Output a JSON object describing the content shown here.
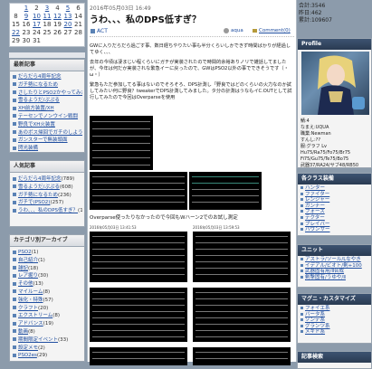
{
  "top_stats": {
    "visitors": "合計:3546",
    "today": "昨日:462",
    "total": "累計:109607"
  },
  "calendar": {
    "rows": [
      [
        {
          "t": "",
          "c": ""
        },
        {
          "t": "1",
          "c": "lnk"
        },
        {
          "t": "2",
          "c": ""
        },
        {
          "t": "3",
          "c": "lnk"
        },
        {
          "t": "4",
          "c": ""
        },
        {
          "t": "5",
          "c": "lnk"
        },
        {
          "t": "6",
          "c": ""
        }
      ],
      [
        {
          "t": "8",
          "c": ""
        },
        {
          "t": "9",
          "c": "lnk"
        },
        {
          "t": "10",
          "c": "lnk"
        },
        {
          "t": "11",
          "c": "lnk"
        },
        {
          "t": "12",
          "c": "lnk"
        },
        {
          "t": "13",
          "c": "lnk"
        },
        {
          "t": "14",
          "c": ""
        }
      ],
      [
        {
          "t": "15",
          "c": ""
        },
        {
          "t": "16",
          "c": ""
        },
        {
          "t": "17",
          "c": "lnk"
        },
        {
          "t": "18",
          "c": ""
        },
        {
          "t": "19",
          "c": ""
        },
        {
          "t": "20",
          "c": "lnk"
        },
        {
          "t": "21",
          "c": ""
        }
      ],
      [
        {
          "t": "22",
          "c": "lnk"
        },
        {
          "t": "23",
          "c": ""
        },
        {
          "t": "24",
          "c": ""
        },
        {
          "t": "25",
          "c": ""
        },
        {
          "t": "26",
          "c": ""
        },
        {
          "t": "27",
          "c": ""
        },
        {
          "t": "28",
          "c": ""
        }
      ],
      [
        {
          "t": "29",
          "c": ""
        },
        {
          "t": "30",
          "c": ""
        },
        {
          "t": "31",
          "c": ""
        },
        {
          "t": "",
          "c": ""
        },
        {
          "t": "",
          "c": ""
        },
        {
          "t": "",
          "c": ""
        },
        {
          "t": "",
          "c": ""
        }
      ]
    ]
  },
  "recent_posts": {
    "title": "最新記事",
    "items": [
      "だらだら4周年記念",
      "ガチ勢になるため",
      "さしたりとPSO2かやってみた",
      "雪るようだ/ぷぷる",
      "XH前方装置/XH",
      "テーセンでノンウイン戦闘",
      "野良でXH火装置",
      "あのボス帰回でガチのしよう?",
      "ガンスターで無装頭面",
      "閃光装備"
    ]
  },
  "popular": {
    "title": "人気記事",
    "items": [
      {
        "label": "だらだら4周年記念",
        "count": "(789)"
      },
      {
        "label": "雪るようだ/ぷぷる",
        "count": "(608)"
      },
      {
        "label": "ガチ勢になるため",
        "count": "(236)"
      },
      {
        "label": "ガチで(PSO2)",
        "count": "(257)"
      },
      {
        "label": "うわ、、、私のDPS低すぎ？",
        "count": "(159)"
      }
    ]
  },
  "categories": {
    "title": "カテゴリ別アーカイブ",
    "items": [
      {
        "label": "PSO2",
        "count": "(1)"
      },
      {
        "label": "自己紹介",
        "count": "(1)"
      },
      {
        "label": "雑記",
        "count": "(18)"
      },
      {
        "label": "レア掘り",
        "count": "(30)"
      },
      {
        "label": "その他",
        "count": "(13)"
      },
      {
        "label": "マイルーム",
        "count": "(8)"
      },
      {
        "label": "強化・特殊",
        "count": "(57)"
      },
      {
        "label": "クラフト",
        "count": "(20)"
      },
      {
        "label": "エクストリーム",
        "count": "(8)"
      },
      {
        "label": "アドバンス",
        "count": "(19)"
      },
      {
        "label": "動画",
        "count": "(8)"
      },
      {
        "label": "期間限定イベント",
        "count": "(33)"
      },
      {
        "label": "設定メモ",
        "count": "(2)"
      },
      {
        "label": "PSO2es",
        "count": "(29)"
      },
      {
        "label": "PSO0B",
        "count": "(2)"
      }
    ]
  },
  "post": {
    "date": "2016年05月03日 16:49",
    "title": "うわ、、、私のDPS低すぎ？",
    "tag": "ACT",
    "author": "aqua",
    "comments": "Comment(0)",
    "body": [
      "GWに入りだらだら過ごす事、数日経ちやりたい事も半分くらいしかできず時間ばかりが経過してゆく、、、",
      "去年の今頃は凄まじい程くらいにガチが実装されたので時間的余裕ありノリで雑話してましたが、今年は何だか実装されな繁急イーに戻ったので、GWはPSO2以外の事でできそうです（・ω・）",
      "繁急もただ参加してる事はないのでそろそろ、DPS計測し「野良ではどのくらいの火力なのか試してみたい何に野良？tweakerでDPS計測してみました。タ分の計測はうなもイC.OUTとして試行してみたので今回はOverparseを使用"
    ],
    "caption": "Overparse使ったりなかったので今回もWハーン2でのお試し測定",
    "shot_date_1": "2016年05月03日 13:41:53",
    "shot_date_2": "2016年05月03日 13:59:53"
  },
  "profile": {
    "title": "Profile",
    "lines": [
      "鯖:4",
      "なまえ:UQUA",
      "職業:Newman",
      "すんし:??",
      "服:グラフ Lv",
      "Hu75/Ra75/Fo75/Br75",
      "Fi75/Gu75/Te75/Bo75",
      "武器37/RA24/サブ48/RB50"
    ]
  },
  "equip": {
    "title": "各クラス装備",
    "items": [
      "ハンター",
      "ファイター",
      "レンジャー",
      "ガンナー",
      "フォース",
      "テクター",
      "ブレイバー",
      "バウンサー"
    ]
  },
  "units": {
    "title": "ユニット",
    "items": [
      "アストラ/ソール/Lなやき",
      "イデアル/ビオト/剣+100",
      "武器固有用/Ⅱ合成",
      "剣撃固有/うゆや/Ⅱ"
    ]
  },
  "mag": {
    "title": "マグニ・カスタマイズ",
    "items": [
      "フォイエ系",
      "バータ系",
      "ゾンデ系",
      "グランツ系",
      "メギド系"
    ]
  },
  "bottom_right": {
    "title": "記事検索"
  }
}
